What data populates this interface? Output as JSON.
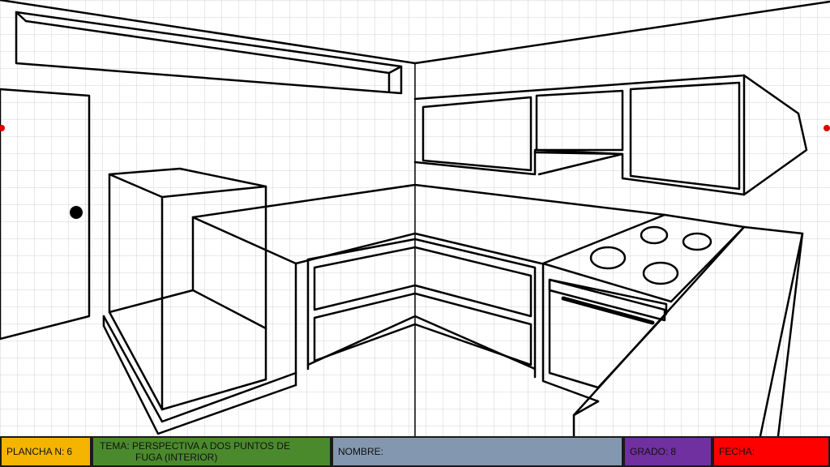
{
  "title_block": {
    "plancha_label": "PLANCHA N:",
    "plancha_value": "6",
    "tema_line1": "TEMA: PERSPECTIVA A DOS PUNTOS DE",
    "tema_line2": "FUGA (INTERIOR)",
    "nombre_label": "NOMBRE:",
    "grado_label": "GRADO:",
    "grado_value": "8",
    "fecha_label": "FECHA:"
  },
  "colors": {
    "plancha": "#f5b400",
    "tema": "#4b8a2c",
    "nombre": "#8497b0",
    "grado": "#7030a0",
    "fecha": "#ff0000",
    "grid": "#cfd3da",
    "ink": "#000000",
    "vanishing_point": "#e00000"
  },
  "drawing": {
    "subject": "kitchen-interior-two-point-perspective",
    "vanishing_points": 2
  }
}
